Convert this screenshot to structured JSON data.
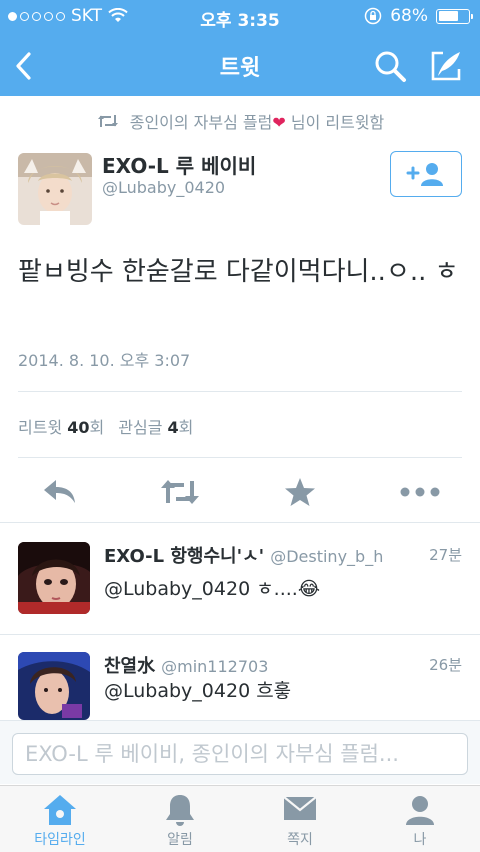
{
  "status_bar": {
    "carrier": "SKT",
    "time": "오후 3:35",
    "battery": "68%",
    "battery_level": 0.68
  },
  "nav": {
    "title": "트윗",
    "back_icon": "chevron-left-icon",
    "search_icon": "search-icon",
    "compose_icon": "compose-icon"
  },
  "retweet_notice": {
    "text_before": "종인이의 자부심 플럼",
    "text_after": "님이 리트윗함"
  },
  "tweet": {
    "author_name": "EXO-L 루 베이비",
    "author_handle": "@Lubaby_0420",
    "text": "팥ㅂ빙수 한숟갈로 다같이먹다니..ㅇ.. ㅎ",
    "timestamp": "2014. 8. 10. 오후 3:07",
    "retweets_label": "리트윗",
    "retweets_count": "40",
    "retweets_unit": "회",
    "favorites_label": "관심글",
    "favorites_count": "4",
    "favorites_unit": "회"
  },
  "replies": [
    {
      "name": "EXO-L 항행수니'ㅅ'",
      "handle": "@Destiny_b_h",
      "time": "27분",
      "text": "@Lubaby_0420 ㅎ....😂"
    },
    {
      "name": "찬열水",
      "handle": "@min112703",
      "time": "26분",
      "text": "@Lubaby_0420 흐흫"
    }
  ],
  "compose": {
    "placeholder": "EXO-L 루 베이비, 종인이의 자부심 플럼..."
  },
  "tabs": [
    {
      "label": "타임라인",
      "icon": "home-icon"
    },
    {
      "label": "알림",
      "icon": "bell-icon"
    },
    {
      "label": "쪽지",
      "icon": "envelope-icon"
    },
    {
      "label": "나",
      "icon": "person-icon"
    }
  ],
  "colors": {
    "accent": "#55acee",
    "text": "#292f33",
    "muted": "#8899a6",
    "heart": "#e0245e"
  }
}
